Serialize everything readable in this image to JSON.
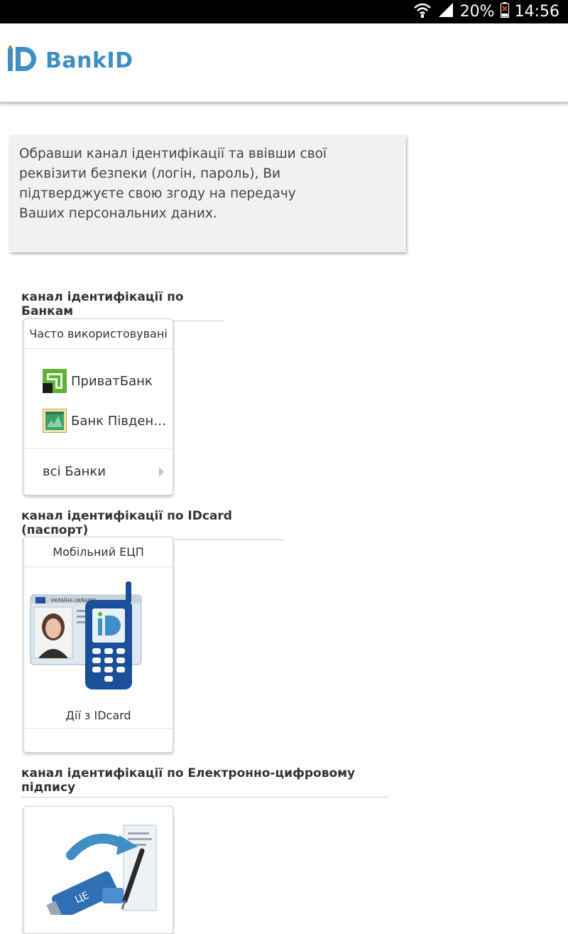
{
  "status_bar": {
    "battery": "20%",
    "time": "14:56"
  },
  "header": {
    "logo_text": "BankID"
  },
  "notice": {
    "text": "Обравши канал ідентифікації та ввівши свої\nреквізити безпеки (логін, пароль), Ви\nпідтверджуєте свою згоду на передачу\nВаших персональних даних."
  },
  "banks_section": {
    "title": "канал ідентифікації по Банкам",
    "card_header": "Часто використовувані",
    "items": [
      {
        "label": "ПриватБанк",
        "icon": "privatbank-logo"
      },
      {
        "label": "Банк Півден…",
        "icon": "bank-pivdennyi-logo"
      }
    ],
    "all_banks_label": "всі Банки"
  },
  "idcard_section": {
    "title": "канал ідентифікації по IDcard (паспорт)",
    "card_header": "Мобільний ЕЦП",
    "caption": "Дії з IDcard"
  },
  "eds_section": {
    "title": "канал ідентифікації по Електронно-цифровому підпису"
  },
  "colors": {
    "brand": "#3f8fc6",
    "privat_green": "#5fb332"
  }
}
